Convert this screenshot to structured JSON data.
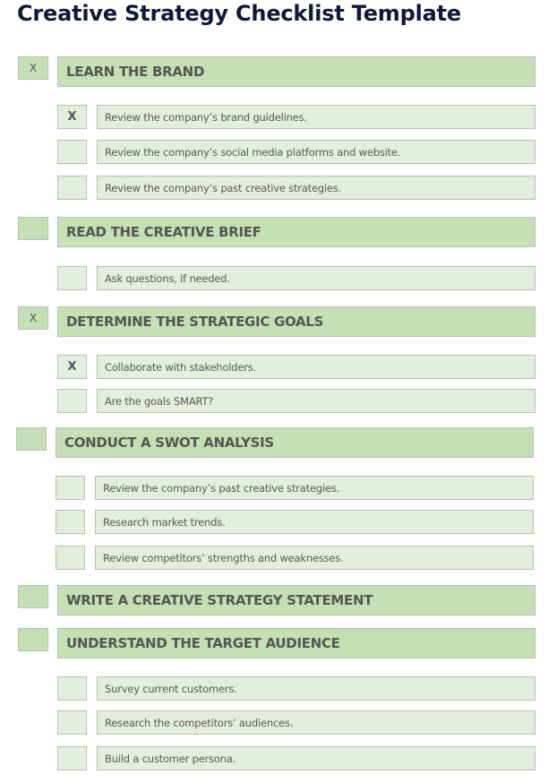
{
  "title": "Creative Strategy Checklist Template",
  "check_mark": "X",
  "sections": [
    {
      "label": "LEARN THE BRAND",
      "checked": true,
      "tasks": [
        {
          "label": "Review the company’s brand guidelines.",
          "checked": true
        },
        {
          "label": "Review the company’s social media platforms and website.",
          "checked": false
        },
        {
          "label": "Review the company’s past creative strategies.",
          "checked": false
        }
      ]
    },
    {
      "label": "READ THE CREATIVE BRIEF",
      "checked": false,
      "tasks": [
        {
          "label": "Ask questions, if needed.",
          "checked": false
        }
      ]
    },
    {
      "label": "DETERMINE THE STRATEGIC GOALS",
      "checked": true,
      "tasks": [
        {
          "label": "Collaborate with stakeholders.",
          "checked": true
        },
        {
          "label": "Are the goals SMART?",
          "checked": false
        }
      ]
    },
    {
      "label": "CONDUCT A SWOT ANALYSIS",
      "checked": false,
      "tasks": [
        {
          "label": "Review the company’s past creative strategies.",
          "checked": false
        },
        {
          "label": "Research market trends.",
          "checked": false
        },
        {
          "label": "Review competitors’ strengths and weaknesses.",
          "checked": false
        }
      ]
    },
    {
      "label": "WRITE A CREATIVE STRATEGY STATEMENT",
      "checked": false,
      "tasks": []
    },
    {
      "label": "UNDERSTAND THE TARGET AUDIENCE",
      "checked": false,
      "tasks": [
        {
          "label": "Survey current customers.",
          "checked": false
        },
        {
          "label": "Research the competitors’ audiences.",
          "checked": false
        },
        {
          "label": "Build a customer persona.",
          "checked": false
        }
      ]
    }
  ]
}
